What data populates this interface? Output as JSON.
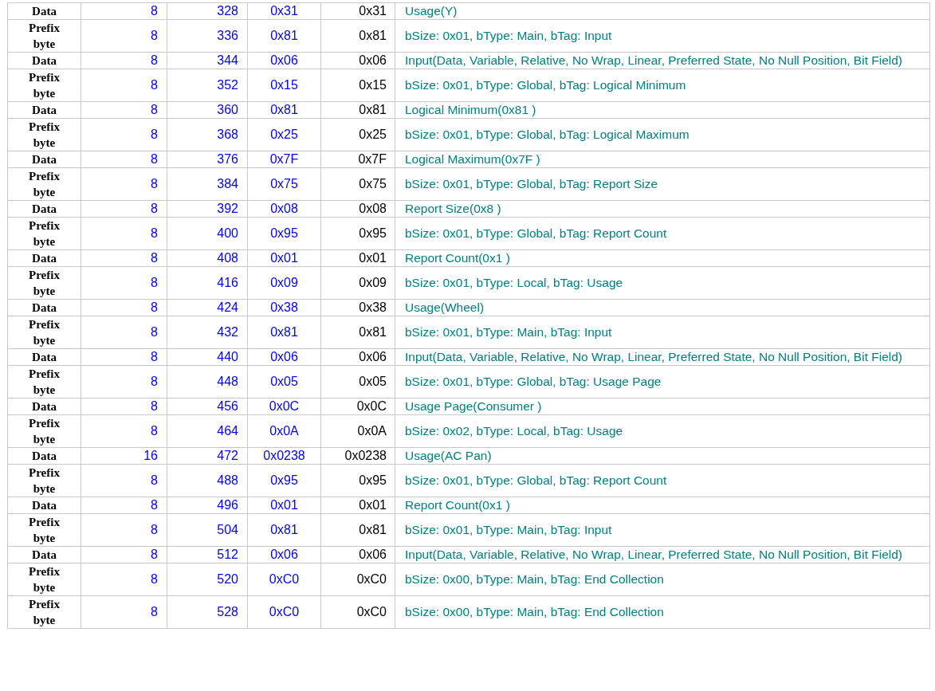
{
  "table": {
    "rows": [
      {
        "column_1": "Data",
        "column_2": "8",
        "column_3": "328",
        "column_4": "0x31",
        "column_5": "0x31",
        "column_6": "Usage(Y)"
      },
      {
        "column_1": "Prefix byte",
        "column_2": "8",
        "column_3": "336",
        "column_4": "0x81",
        "column_5": "0x81",
        "column_6": "bSize: 0x01, bType: Main, bTag: Input"
      },
      {
        "column_1": "Data",
        "column_2": "8",
        "column_3": "344",
        "column_4": "0x06",
        "column_5": "0x06",
        "column_6": "Input(Data, Variable, Relative, No Wrap, Linear, Preferred State, No Null Position, Bit Field)"
      },
      {
        "column_1": "Prefix byte",
        "column_2": "8",
        "column_3": "352",
        "column_4": "0x15",
        "column_5": "0x15",
        "column_6": "bSize: 0x01, bType: Global, bTag: Logical Minimum"
      },
      {
        "column_1": "Data",
        "column_2": "8",
        "column_3": "360",
        "column_4": "0x81",
        "column_5": "0x81",
        "column_6": "Logical Minimum(0x81 )"
      },
      {
        "column_1": "Prefix byte",
        "column_2": "8",
        "column_3": "368",
        "column_4": "0x25",
        "column_5": "0x25",
        "column_6": "bSize: 0x01, bType: Global, bTag: Logical Maximum"
      },
      {
        "column_1": "Data",
        "column_2": "8",
        "column_3": "376",
        "column_4": "0x7F",
        "column_5": "0x7F",
        "column_6": "Logical Maximum(0x7F )"
      },
      {
        "column_1": "Prefix byte",
        "column_2": "8",
        "column_3": "384",
        "column_4": "0x75",
        "column_5": "0x75",
        "column_6": "bSize: 0x01, bType: Global, bTag: Report Size"
      },
      {
        "column_1": "Data",
        "column_2": "8",
        "column_3": "392",
        "column_4": "0x08",
        "column_5": "0x08",
        "column_6": "Report Size(0x8 )"
      },
      {
        "column_1": "Prefix byte",
        "column_2": "8",
        "column_3": "400",
        "column_4": "0x95",
        "column_5": "0x95",
        "column_6": "bSize: 0x01, bType: Global, bTag: Report Count"
      },
      {
        "column_1": "Data",
        "column_2": "8",
        "column_3": "408",
        "column_4": "0x01",
        "column_5": "0x01",
        "column_6": "Report Count(0x1 )"
      },
      {
        "column_1": "Prefix byte",
        "column_2": "8",
        "column_3": "416",
        "column_4": "0x09",
        "column_5": "0x09",
        "column_6": "bSize: 0x01, bType: Local, bTag: Usage"
      },
      {
        "column_1": "Data",
        "column_2": "8",
        "column_3": "424",
        "column_4": "0x38",
        "column_5": "0x38",
        "column_6": "Usage(Wheel)"
      },
      {
        "column_1": "Prefix byte",
        "column_2": "8",
        "column_3": "432",
        "column_4": "0x81",
        "column_5": "0x81",
        "column_6": "bSize: 0x01, bType: Main, bTag: Input"
      },
      {
        "column_1": "Data",
        "column_2": "8",
        "column_3": "440",
        "column_4": "0x06",
        "column_5": "0x06",
        "column_6": "Input(Data, Variable, Relative, No Wrap, Linear, Preferred State, No Null Position, Bit Field)"
      },
      {
        "column_1": "Prefix byte",
        "column_2": "8",
        "column_3": "448",
        "column_4": "0x05",
        "column_5": "0x05",
        "column_6": "bSize: 0x01, bType: Global, bTag: Usage Page"
      },
      {
        "column_1": "Data",
        "column_2": "8",
        "column_3": "456",
        "column_4": "0x0C",
        "column_5": "0x0C",
        "column_6": "Usage Page(Consumer )"
      },
      {
        "column_1": "Prefix byte",
        "column_2": "8",
        "column_3": "464",
        "column_4": "0x0A",
        "column_5": "0x0A",
        "column_6": "bSize: 0x02, bType: Local, bTag: Usage"
      },
      {
        "column_1": "Data",
        "column_2": "16",
        "column_3": "472",
        "column_4": "0x0238",
        "column_5": "0x0238",
        "column_6": "Usage(AC Pan)"
      },
      {
        "column_1": "Prefix byte",
        "column_2": "8",
        "column_3": "488",
        "column_4": "0x95",
        "column_5": "0x95",
        "column_6": "bSize: 0x01, bType: Global, bTag: Report Count"
      },
      {
        "column_1": "Data",
        "column_2": "8",
        "column_3": "496",
        "column_4": "0x01",
        "column_5": "0x01",
        "column_6": "Report Count(0x1 )"
      },
      {
        "column_1": "Prefix byte",
        "column_2": "8",
        "column_3": "504",
        "column_4": "0x81",
        "column_5": "0x81",
        "column_6": "bSize: 0x01, bType: Main, bTag: Input"
      },
      {
        "column_1": "Data",
        "column_2": "8",
        "column_3": "512",
        "column_4": "0x06",
        "column_5": "0x06",
        "column_6": "Input(Data, Variable, Relative, No Wrap, Linear, Preferred State, No Null Position, Bit Field)"
      },
      {
        "column_1": "Prefix byte",
        "column_2": "8",
        "column_3": "520",
        "column_4": "0xC0",
        "column_5": "0xC0",
        "column_6": "bSize: 0x00, bType: Main, bTag: End Collection"
      },
      {
        "column_1": "Prefix byte",
        "column_2": "8",
        "column_3": "528",
        "column_4": "0xC0",
        "column_5": "0xC0",
        "column_6": "bSize: 0x00, bType: Main, bTag: End Collection"
      }
    ]
  }
}
